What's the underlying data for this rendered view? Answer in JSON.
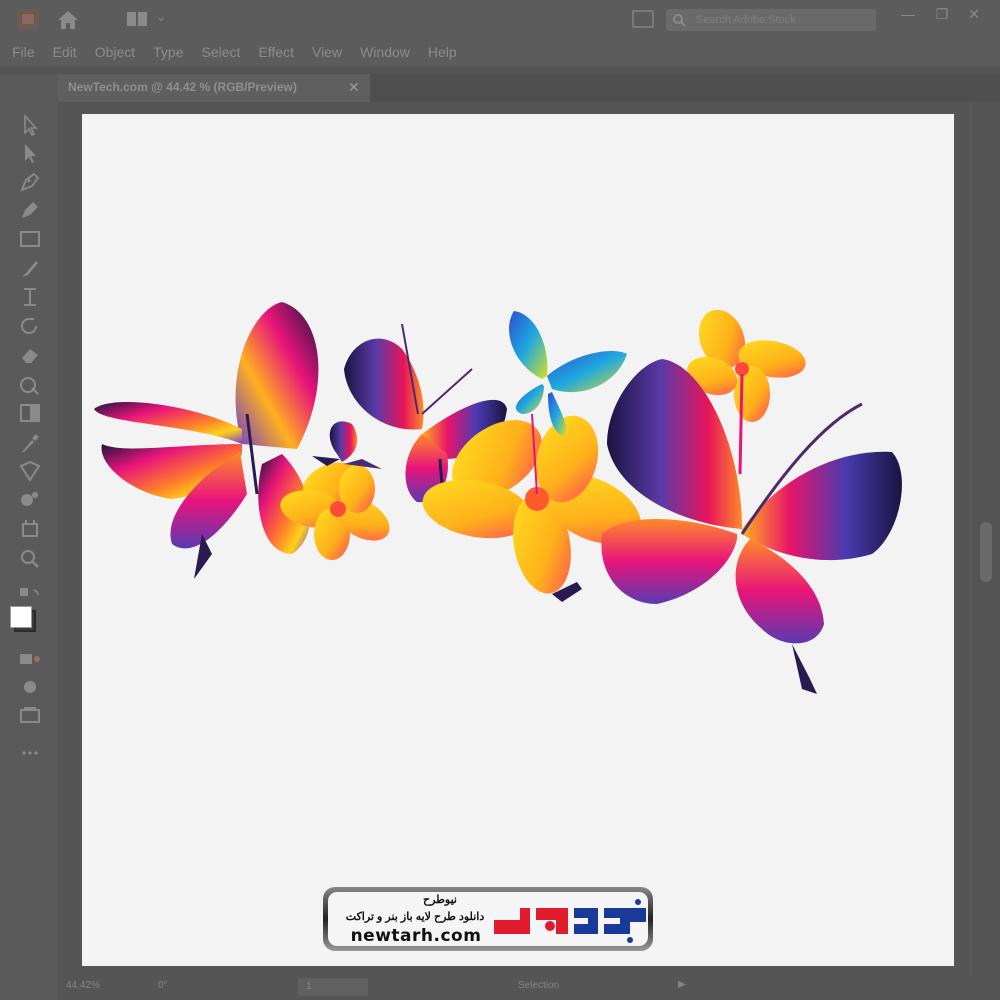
{
  "app": {
    "window_title": "",
    "search_placeholder": "Search Adobe Stock",
    "window_buttons": {
      "minimize": "—",
      "restore": "❐",
      "close": "✕"
    }
  },
  "menu": [
    "File",
    "Edit",
    "Object",
    "Type",
    "Select",
    "Effect",
    "View",
    "Window",
    "Help"
  ],
  "document_tab": {
    "label": "NewTech.com @ 44.42 % (RGB/Preview)",
    "close": "✕"
  },
  "tools": [
    "selection-tool-icon",
    "direct-selection-tool-icon",
    "pen-tool-icon",
    "curvature-tool-icon",
    "rectangle-tool-icon",
    "paintbrush-tool-icon",
    "width-tool-icon",
    "rotate-tool-icon",
    "eraser-tool-icon",
    "shape-builder-tool-icon",
    "gradient-tool-icon",
    "eyedropper-tool-icon",
    "blend-tool-icon",
    "symbol-sprayer-tool-icon",
    "artboard-tool-icon",
    "zoom-tool-icon"
  ],
  "fill_color": "#ffffff",
  "stroke_color": "#000000",
  "status": {
    "zoom": "44.42%",
    "rotation": "0°",
    "page": "1",
    "tool": "Selection",
    "play": "▶"
  },
  "watermark": {
    "name_fa": "نیوطرح",
    "tagline_fa": "دانلود طرح لایه باز بنر و تراکت",
    "url": "newtarh.com",
    "logo_text": "نیوطرح"
  },
  "colors": {
    "artboard": "#f3f3f3",
    "ui_bg": "#5a5a5a",
    "logo_red": "#e01b2e",
    "logo_blue": "#1a3a9a"
  }
}
